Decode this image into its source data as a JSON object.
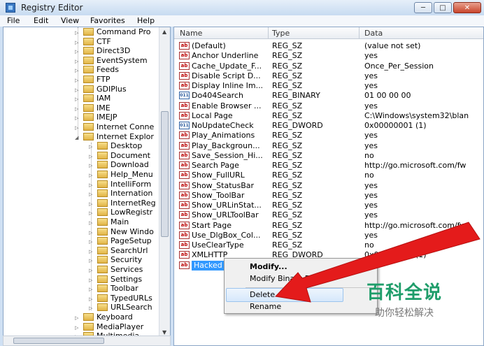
{
  "window": {
    "title": "Registry Editor"
  },
  "menubar": [
    "File",
    "Edit",
    "View",
    "Favorites",
    "Help"
  ],
  "tree": {
    "items": [
      {
        "label": "Command Pro",
        "level": 1
      },
      {
        "label": "CTF",
        "level": 1
      },
      {
        "label": "Direct3D",
        "level": 1
      },
      {
        "label": "EventSystem",
        "level": 1
      },
      {
        "label": "Feeds",
        "level": 1
      },
      {
        "label": "FTP",
        "level": 1
      },
      {
        "label": "GDIPlus",
        "level": 1
      },
      {
        "label": "IAM",
        "level": 1
      },
      {
        "label": "IME",
        "level": 1
      },
      {
        "label": "IMEJP",
        "level": 1
      },
      {
        "label": "Internet Conne",
        "level": 1
      },
      {
        "label": "Internet Explor",
        "level": 1,
        "expanded": true
      },
      {
        "label": "Desktop",
        "level": 2
      },
      {
        "label": "Document",
        "level": 2
      },
      {
        "label": "Download",
        "level": 2
      },
      {
        "label": "Help_Menu",
        "level": 2
      },
      {
        "label": "IntelliForm",
        "level": 2
      },
      {
        "label": "Internation",
        "level": 2
      },
      {
        "label": "InternetReg",
        "level": 2
      },
      {
        "label": "LowRegistr",
        "level": 2
      },
      {
        "label": "Main",
        "level": 2
      },
      {
        "label": "New Windo",
        "level": 2
      },
      {
        "label": "PageSetup",
        "level": 2
      },
      {
        "label": "SearchUrl",
        "level": 2
      },
      {
        "label": "Security",
        "level": 2
      },
      {
        "label": "Services",
        "level": 2
      },
      {
        "label": "Settings",
        "level": 2
      },
      {
        "label": "Toolbar",
        "level": 2
      },
      {
        "label": "TypedURLs",
        "level": 2
      },
      {
        "label": "URLSearch",
        "level": 2
      },
      {
        "label": "Keyboard",
        "level": 1
      },
      {
        "label": "MediaPlayer",
        "level": 1
      },
      {
        "label": "Multimedia",
        "level": 1
      }
    ]
  },
  "list": {
    "columns": [
      "Name",
      "Type",
      "Data"
    ],
    "rows": [
      {
        "icon": "ab",
        "name": "(Default)",
        "type": "REG_SZ",
        "data": "(value not set)"
      },
      {
        "icon": "ab",
        "name": "Anchor Underline",
        "type": "REG_SZ",
        "data": "yes"
      },
      {
        "icon": "ab",
        "name": "Cache_Update_F...",
        "type": "REG_SZ",
        "data": "Once_Per_Session"
      },
      {
        "icon": "ab",
        "name": "Disable Script D...",
        "type": "REG_SZ",
        "data": "yes"
      },
      {
        "icon": "ab",
        "name": "Display Inline Im...",
        "type": "REG_SZ",
        "data": "yes"
      },
      {
        "icon": "bin",
        "name": "Do404Search",
        "type": "REG_BINARY",
        "data": "01 00 00 00"
      },
      {
        "icon": "ab",
        "name": "Enable Browser ...",
        "type": "REG_SZ",
        "data": "yes"
      },
      {
        "icon": "ab",
        "name": "Local Page",
        "type": "REG_SZ",
        "data": "C:\\Windows\\system32\\blan"
      },
      {
        "icon": "bin",
        "name": "NoUpdateCheck",
        "type": "REG_DWORD",
        "data": "0x00000001 (1)"
      },
      {
        "icon": "ab",
        "name": "Play_Animations",
        "type": "REG_SZ",
        "data": "yes"
      },
      {
        "icon": "ab",
        "name": "Play_Backgroun...",
        "type": "REG_SZ",
        "data": "yes"
      },
      {
        "icon": "ab",
        "name": "Save_Session_Hi...",
        "type": "REG_SZ",
        "data": "no"
      },
      {
        "icon": "ab",
        "name": "Search Page",
        "type": "REG_SZ",
        "data": "http://go.microsoft.com/fw"
      },
      {
        "icon": "ab",
        "name": "Show_FullURL",
        "type": "REG_SZ",
        "data": "no"
      },
      {
        "icon": "ab",
        "name": "Show_StatusBar",
        "type": "REG_SZ",
        "data": "yes"
      },
      {
        "icon": "ab",
        "name": "Show_ToolBar",
        "type": "REG_SZ",
        "data": "yes"
      },
      {
        "icon": "ab",
        "name": "Show_URLinStat...",
        "type": "REG_SZ",
        "data": "yes"
      },
      {
        "icon": "ab",
        "name": "Show_URLToolBar",
        "type": "REG_SZ",
        "data": "yes"
      },
      {
        "icon": "ab",
        "name": "Start Page",
        "type": "REG_SZ",
        "data": "http://go.microsoft.com/fw"
      },
      {
        "icon": "ab",
        "name": "Use_DlgBox_Col...",
        "type": "REG_SZ",
        "data": "yes"
      },
      {
        "icon": "ab",
        "name": "UseClearType",
        "type": "REG_SZ",
        "data": "no"
      },
      {
        "icon": "ab",
        "name": "XMLHTTP",
        "type": "REG_DWORD",
        "data": "0x00000001 (1)"
      },
      {
        "icon": "ab",
        "name": "Hacked",
        "type": "",
        "data": "",
        "selected": true
      }
    ]
  },
  "context_menu": {
    "items": [
      "Modify...",
      "Modify Binary Data...",
      "Delete",
      "Rename"
    ],
    "highlighted": "Delete"
  },
  "watermark": {
    "title": "百科全说",
    "subtitle": "助你轻松解决"
  },
  "colors": {
    "arrow": "#e41b1b",
    "selection": "#3399ff",
    "watermark": "#1f9d6a"
  }
}
